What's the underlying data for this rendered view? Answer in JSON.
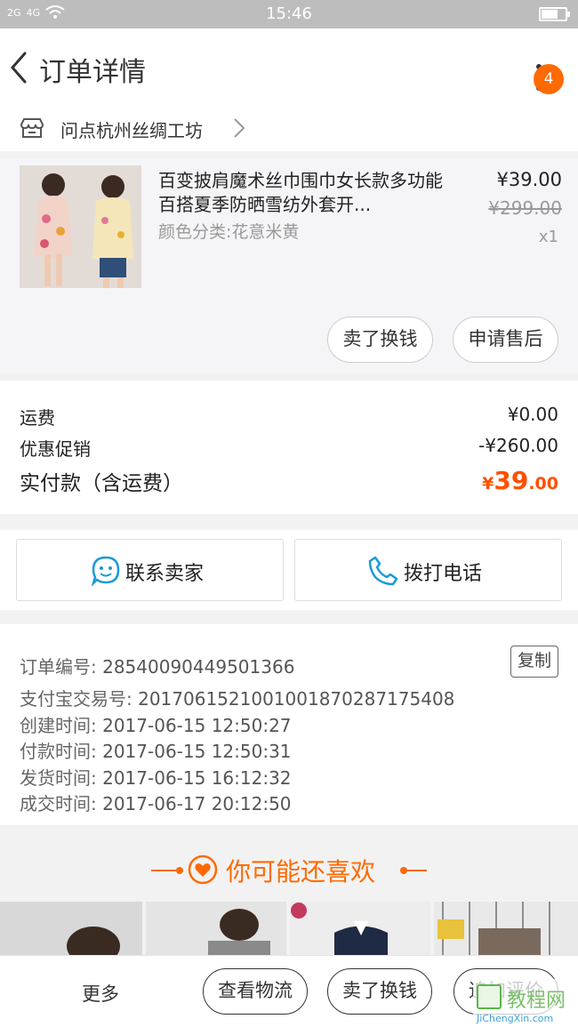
{
  "status_bar": {
    "network_left": "2G",
    "network_right": "4G",
    "time": "15:46"
  },
  "nav": {
    "title": "订单详情",
    "badge": "4"
  },
  "shop": {
    "name": "问点杭州丝绸工坊"
  },
  "product": {
    "title": "百变披肩魔术丝巾围巾女长款多功能百搭夏季防晒雪纺外套开...",
    "spec": "颜色分类:花意米黄",
    "price": "¥39.00",
    "original_price": "¥299.00",
    "quantity": "x1",
    "sell_button": "卖了换钱",
    "aftersale_button": "申请售后"
  },
  "costs": {
    "shipping_label": "运费",
    "shipping_value": "¥0.00",
    "discount_label": "优惠促销",
    "discount_value": "-¥260.00",
    "total_label": "实付款（含运费）",
    "total_currency": "¥",
    "total_integer": "39",
    "total_decimal": ".00"
  },
  "contact": {
    "seller_label": "联系卖家",
    "call_label": "拨打电话"
  },
  "order_info": {
    "copy_button": "复制",
    "rows": [
      {
        "label": "订单编号:",
        "value": "28540090449501366"
      },
      {
        "label": "支付宝交易号:",
        "value": "2017061521001001870287175408"
      },
      {
        "label": "创建时间:",
        "value": "2017-06-15 12:50:27"
      },
      {
        "label": "付款时间:",
        "value": "2017-06-15 12:50:31"
      },
      {
        "label": "发货时间:",
        "value": "2017-06-15 16:12:32"
      },
      {
        "label": "成交时间:",
        "value": "2017-06-17 20:12:50"
      }
    ]
  },
  "recommend": {
    "title": "你可能还喜欢"
  },
  "bottom_bar": {
    "more": "更多",
    "logistics_button": "查看物流",
    "sell_button": "卖了换钱",
    "review_button": "追加评价"
  },
  "watermark": {
    "brand": "教程网",
    "url": "JiChengXin.com"
  },
  "colors": {
    "accent": "#ff6a00",
    "price_total": "#ff5000",
    "icon_blue": "#1a9ad6"
  }
}
